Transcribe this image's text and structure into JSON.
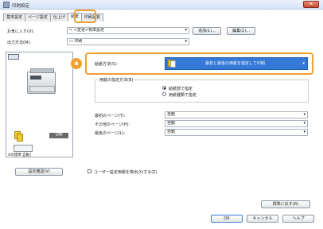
{
  "window": {
    "title": "印刷設定",
    "close_label": "✕"
  },
  "tabs": [
    {
      "label": "基本設定",
      "active": false
    },
    {
      "label": "ページ設定",
      "active": false
    },
    {
      "label": "仕上げ",
      "active": false
    },
    {
      "label": "給紙",
      "active": true
    },
    {
      "label": "印刷品質",
      "active": false
    }
  ],
  "favorites": {
    "label": "お気に入り(V):",
    "value": "<変更>標準設定",
    "add_button": "追加(1)...",
    "edit_button": "編集(2)..."
  },
  "output": {
    "label": "出力方法(M):",
    "value": "印刷"
  },
  "preview": {
    "badge": "自動",
    "caption": "A4[標準 自動]"
  },
  "callout": {
    "letter": "a"
  },
  "paper_source": {
    "label": "給紙方法(S):",
    "value": "最初と最後の用紙を指定して印刷"
  },
  "paper_spec": {
    "label": "用紙の指定方法(B)",
    "options": [
      {
        "label": "給紙部で指定",
        "checked": true
      },
      {
        "label": "用紙種類で指定",
        "checked": false
      }
    ]
  },
  "page_sources": [
    {
      "label": "最初のページ(T):",
      "value": "自動"
    },
    {
      "label": "その他のページ(H):",
      "value": "自動"
    },
    {
      "label": "最後のページ(L):",
      "value": "自動"
    }
  ],
  "settings_check_button": "設定確認(V)",
  "custom_paper_checkbox": {
    "label": "ユーザー設定用紙を検出(X)する(Z)",
    "checked": false
  },
  "restore_defaults_button": "標準に戻す(R)",
  "footer": {
    "ok": "OK",
    "cancel": "キャンセル",
    "help": "ヘルプ"
  },
  "colors": {
    "accent": "#f0a030",
    "selection": "#3478d8"
  },
  "icons": {
    "close": "close-icon",
    "dropdown": "chevron-down-icon",
    "pencil": "pencil-icon",
    "printer": "printer-icon",
    "tray": "paper-tray-icon"
  }
}
